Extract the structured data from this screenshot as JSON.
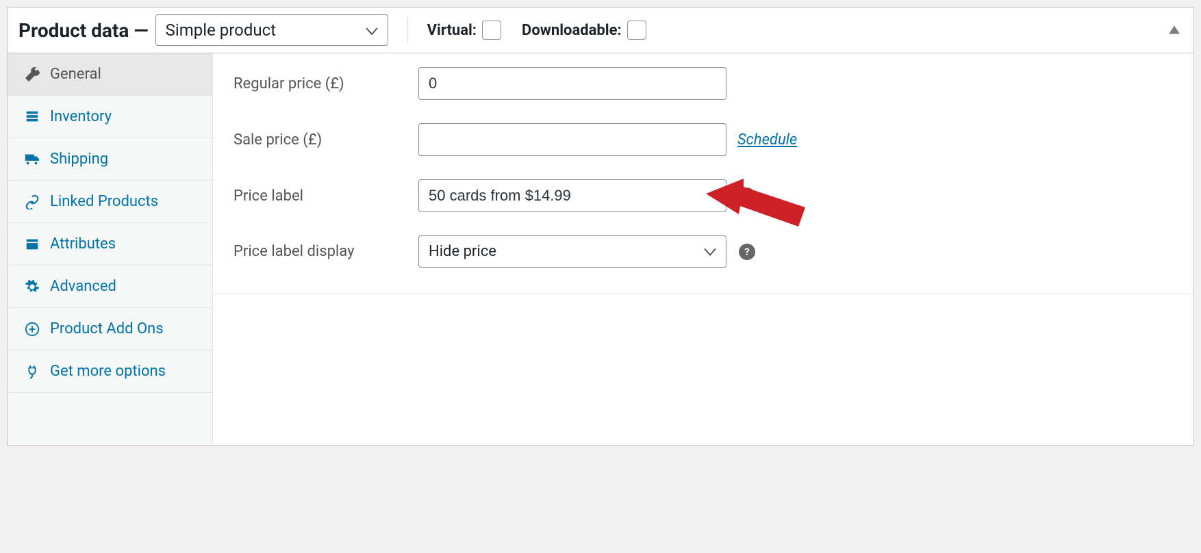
{
  "header": {
    "title": "Product data —",
    "product_type": "Simple product",
    "virtual_label": "Virtual:",
    "downloadable_label": "Downloadable:"
  },
  "sidebar": {
    "items": [
      {
        "label": "General"
      },
      {
        "label": "Inventory"
      },
      {
        "label": "Shipping"
      },
      {
        "label": "Linked Products"
      },
      {
        "label": "Attributes"
      },
      {
        "label": "Advanced"
      },
      {
        "label": "Product Add Ons"
      },
      {
        "label": "Get more options"
      }
    ]
  },
  "form": {
    "regular_price_label": "Regular price (£)",
    "regular_price_value": "0",
    "sale_price_label": "Sale price (£)",
    "sale_price_value": "",
    "schedule_link": "Schedule",
    "price_label_label": "Price label",
    "price_label_value": "50 cards from $14.99",
    "price_label_display_label": "Price label display",
    "price_label_display_value": "Hide price"
  },
  "help_glyph": "?"
}
